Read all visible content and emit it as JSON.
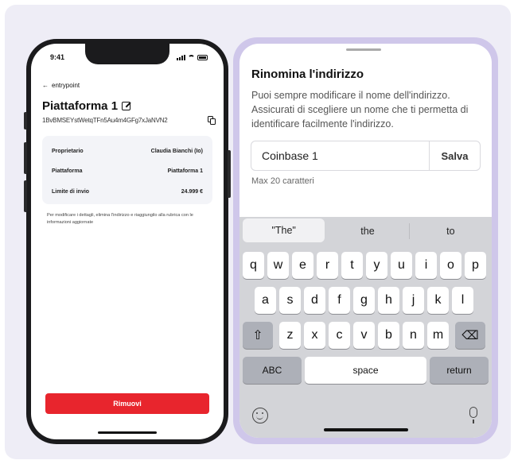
{
  "left_phone": {
    "status_time": "9:41",
    "back_label": "entrypoint",
    "title": "Piattaforma 1",
    "address": "1BvBMSEYstWetqTFn5Au4m4GFg7xJaNVN2",
    "info_rows": [
      {
        "label": "Proprietario",
        "value": "Claudia Bianchi (Io)"
      },
      {
        "label": "Piattaforma",
        "value": "Piattaforma 1"
      },
      {
        "label": "Limite di invio",
        "value": "24.999 €"
      }
    ],
    "note": "Per modificare i dettagli, elimina l'indirizzo e riaggiungilo alla rubrica con le informazioni aggiornate",
    "remove_label": "Rimuovi"
  },
  "right_phone": {
    "title": "Rinomina l'indirizzo",
    "description": "Puoi sempre modificare il nome dell'indirizzo. Assicurati di scegliere un nome che ti permetta di identificare facilmente l'indirizzo.",
    "input_value": "Coinbase 1",
    "save_label": "Salva",
    "hint": "Max 20 caratteri",
    "keyboard": {
      "suggestions": [
        "\"The\"",
        "the",
        "to"
      ],
      "row1": [
        "q",
        "w",
        "e",
        "r",
        "t",
        "y",
        "u",
        "i",
        "o",
        "p"
      ],
      "row2": [
        "a",
        "s",
        "d",
        "f",
        "g",
        "h",
        "j",
        "k",
        "l"
      ],
      "row3": [
        "z",
        "x",
        "c",
        "v",
        "b",
        "n",
        "m"
      ],
      "abc_label": "ABC",
      "space_label": "space",
      "return_label": "return"
    }
  },
  "colors": {
    "background": "#eeedf6",
    "accent_red": "#e8252d",
    "frame_purple": "#cfc7ea"
  }
}
